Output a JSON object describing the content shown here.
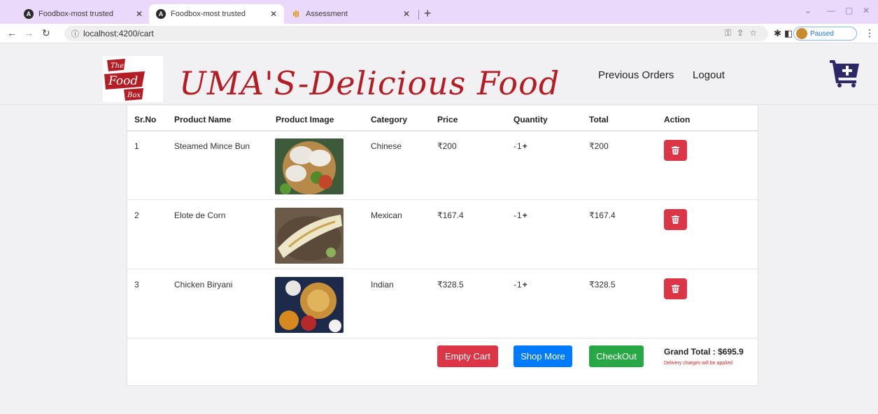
{
  "browser": {
    "tabs": [
      {
        "title": "Foodbox-most trusted",
        "active": false,
        "favicon": "angular-icon"
      },
      {
        "title": "Foodbox-most trusted",
        "active": true,
        "favicon": "angular-icon"
      },
      {
        "title": "Assessment",
        "active": false,
        "favicon": "analytics-icon"
      }
    ],
    "url": "localhost:4200/cart",
    "profile_status": "Paused"
  },
  "header": {
    "logo_text": [
      "The",
      "Food",
      "Box"
    ],
    "brand_title": "UMA'S-Delicious Food",
    "nav": [
      "Previous Orders",
      "Logout"
    ]
  },
  "cart": {
    "columns": [
      "Sr.No",
      "Product Name",
      "Product Image",
      "Category",
      "Price",
      "Quantity",
      "Total",
      "Action"
    ],
    "rows": [
      {
        "sr": "1",
        "name": "Steamed Mince Bun",
        "image": "dumplings-photo",
        "category": "Chinese",
        "price": "₹200",
        "qty": "1",
        "total": "₹200"
      },
      {
        "sr": "2",
        "name": "Elote de Corn",
        "image": "grilled-corn-photo",
        "category": "Mexican",
        "price": "₹167.4",
        "qty": "1",
        "total": "₹167.4"
      },
      {
        "sr": "3",
        "name": "Chicken Biryani",
        "image": "biryani-photo",
        "category": "Indian",
        "price": "₹328.5",
        "qty": "1",
        "total": "₹328.5"
      }
    ],
    "qty_minus": "-",
    "qty_plus": "+",
    "buttons": {
      "empty": "Empty Cart",
      "shop_more": "Shop More",
      "checkout": "CheckOut"
    },
    "grand_total": "Grand Total : $695.9",
    "delivery_note": "Delivery charges will be applied"
  },
  "colors": {
    "brand_red": "#b51d24",
    "danger": "#dc3545",
    "primary": "#007bff",
    "success": "#28a745",
    "cart_icon": "#2c2867",
    "tab_strip": "#ead9fb"
  }
}
